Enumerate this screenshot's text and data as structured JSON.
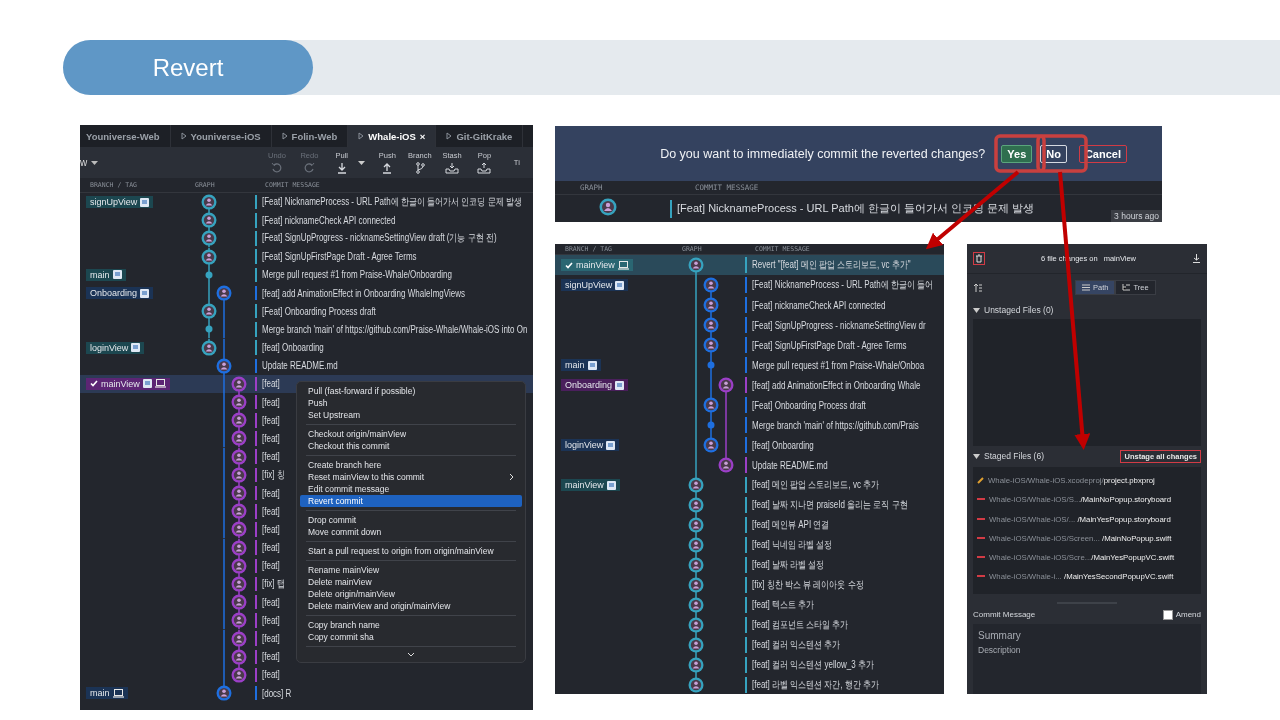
{
  "slide": {
    "title": "Revert"
  },
  "left_screenshot": {
    "tabs": [
      {
        "label": "Youniverse-Web",
        "selected": false,
        "icon": false
      },
      {
        "label": "Youniverse-iOS",
        "selected": false,
        "icon": true
      },
      {
        "label": "Folin-Web",
        "selected": false,
        "icon": true
      },
      {
        "label": "Whale-iOS",
        "selected": true,
        "icon": true,
        "close": "×"
      },
      {
        "label": "Git-GitKrake",
        "selected": false,
        "icon": true
      }
    ],
    "repo_selector": {
      "label": "w"
    },
    "toolbar": [
      {
        "label": "Undo",
        "kind": "undo",
        "disabled": true
      },
      {
        "label": "Redo",
        "kind": "redo",
        "disabled": true
      },
      {
        "label": "Pull",
        "kind": "pull",
        "disabled": false,
        "dropdown": true
      },
      {
        "label": "Push",
        "kind": "push",
        "disabled": false
      },
      {
        "label": "Branch",
        "kind": "branch",
        "disabled": false
      },
      {
        "label": "Stash",
        "kind": "stash",
        "disabled": false
      },
      {
        "label": "Pop",
        "kind": "pop",
        "disabled": false
      },
      {
        "label": "Ti",
        "kind": "other",
        "disabled": false
      }
    ],
    "columns": [
      "BRANCH / TAG",
      "GRAPH",
      "COMMIT MESSAGE"
    ],
    "rows": [
      {
        "branch": {
          "name": "signUpView",
          "color": "#1c4750",
          "checked": false,
          "doc_icon": true,
          "laptop_icon": false
        },
        "kind": "commit",
        "color": "#36a3bf",
        "message": "[Feat] NicknameProcess - URL Path에 한글이 들어가서 인코딩 문제 발생",
        "selected": false
      },
      {
        "kind": "commit",
        "color": "#36a3bf",
        "message": "[Feat] nicknameCheck API connected",
        "selected": false
      },
      {
        "kind": "commit",
        "color": "#36a3bf",
        "message": "[Feat] SignUpProgress - nicknameSettingView draft (기능 구현 전)",
        "selected": false
      },
      {
        "kind": "commit",
        "color": "#36a3bf",
        "message": "[Feat] SignUpFirstPage Draft - Agree Terms",
        "selected": false
      },
      {
        "branch": {
          "name": "main",
          "color": "#1c4750",
          "checked": false,
          "doc_icon": true,
          "laptop_icon": false
        },
        "kind": "merge",
        "color": "#36a3bf",
        "message": "Merge pull request #1 from Praise-Whale/Onboarding",
        "selected": false
      },
      {
        "branch": {
          "name": "Onboarding",
          "color": "#1b3355",
          "checked": false,
          "doc_icon": true,
          "laptop_icon": false
        },
        "kind": "commit",
        "color": "#1e6fe0",
        "message": "[feat] add AnimationEffect in Onboarding WhaleImgViews",
        "selected": false
      },
      {
        "kind": "commit",
        "color": "#36a3bf",
        "message": "[Feat] Onboarding Process draft",
        "selected": false
      },
      {
        "kind": "merge",
        "color": "#36a3bf",
        "message": "Merge branch 'main' of https://github.com/Praise-Whale/Whale-iOS into On",
        "selected": false
      },
      {
        "branch": {
          "name": "loginView",
          "color": "#1c4750",
          "checked": false,
          "doc_icon": true,
          "laptop_icon": false
        },
        "kind": "commit",
        "color": "#36a3bf",
        "message": "[feat] Onboarding",
        "selected": false
      },
      {
        "kind": "commit",
        "color": "#1e6fe0",
        "message": "Update README.md",
        "selected": false
      },
      {
        "branch": {
          "name": "mainView",
          "color": "#5c2574",
          "checked": true,
          "doc_icon": true,
          "laptop_icon": true
        },
        "kind": "commit",
        "color": "#9b3fc7",
        "message": "[feat]",
        "selected": true
      },
      {
        "kind": "commit",
        "color": "#9b3fc7",
        "message": "[feat]",
        "selected": false
      },
      {
        "kind": "commit",
        "color": "#9b3fc7",
        "message": "[feat]",
        "selected": false
      },
      {
        "kind": "commit",
        "color": "#9b3fc7",
        "message": "[feat]",
        "selected": false
      },
      {
        "kind": "commit",
        "color": "#9b3fc7",
        "message": "[feat]",
        "selected": false
      },
      {
        "kind": "commit",
        "color": "#9b3fc7",
        "message": "[fix] 칭",
        "selected": false
      },
      {
        "kind": "commit",
        "color": "#9b3fc7",
        "message": "[feat]",
        "selected": false
      },
      {
        "kind": "commit",
        "color": "#9b3fc7",
        "message": "[feat]",
        "selected": false
      },
      {
        "kind": "commit",
        "color": "#9b3fc7",
        "message": "[feat]",
        "selected": false
      },
      {
        "kind": "commit",
        "color": "#9b3fc7",
        "message": "[feat]",
        "selected": false
      },
      {
        "kind": "commit",
        "color": "#9b3fc7",
        "message": "[feat]",
        "selected": false
      },
      {
        "kind": "commit",
        "color": "#9b3fc7",
        "message": "[fix] 탭",
        "selected": false
      },
      {
        "kind": "commit",
        "color": "#9b3fc7",
        "message": "[feat]",
        "selected": false
      },
      {
        "kind": "commit",
        "color": "#9b3fc7",
        "message": "[feat]",
        "selected": false
      },
      {
        "kind": "commit",
        "color": "#9b3fc7",
        "message": "[feat]",
        "selected": false
      },
      {
        "kind": "commit",
        "color": "#9b3fc7",
        "message": "[feat]",
        "selected": false
      },
      {
        "kind": "commit",
        "color": "#9b3fc7",
        "message": "[feat]",
        "selected": false
      },
      {
        "branch": {
          "name": "main",
          "color": "#1b3355",
          "checked": false,
          "doc_icon": false,
          "laptop_icon": true
        },
        "kind": "commit",
        "color": "#1e6fe0",
        "message": "[docs] R",
        "selected": false
      }
    ],
    "context_menu": {
      "groups": [
        {
          "items": [
            {
              "label": "Pull (fast-forward if possible)",
              "selected": false
            },
            {
              "label": "Push",
              "selected": false
            },
            {
              "label": "Set Upstream",
              "selected": false
            }
          ]
        },
        {
          "items": [
            {
              "label": "Checkout origin/mainView",
              "selected": false
            },
            {
              "label": "Checkout this commit",
              "selected": false
            }
          ]
        },
        {
          "items": [
            {
              "label": "Create branch here",
              "selected": false
            },
            {
              "label": "Reset mainView to this commit",
              "selected": false,
              "submenu": true
            },
            {
              "label": "Edit commit message",
              "selected": false
            },
            {
              "label": "Revert commit",
              "selected": true
            }
          ]
        },
        {
          "items": [
            {
              "label": "Drop commit",
              "selected": false
            },
            {
              "label": "Move commit down",
              "selected": false
            }
          ]
        },
        {
          "items": [
            {
              "label": "Start a pull request to origin from origin/mainView",
              "selected": false
            }
          ]
        },
        {
          "items": [
            {
              "label": "Rename mainView",
              "selected": false
            },
            {
              "label": "Delete mainView",
              "selected": false
            },
            {
              "label": "Delete origin/mainView",
              "selected": false
            },
            {
              "label": "Delete mainView and origin/mainView",
              "selected": false
            }
          ]
        },
        {
          "items": [
            {
              "label": "Copy branch name",
              "selected": false
            },
            {
              "label": "Copy commit sha",
              "selected": false
            }
          ]
        }
      ]
    }
  },
  "dialog_screenshot": {
    "question": "Do you want to immediately commit the reverted changes?",
    "buttons": [
      {
        "label": "Yes",
        "kind": "confirm"
      },
      {
        "label": "No",
        "kind": "plain"
      },
      {
        "label": "Cancel",
        "kind": "cancel"
      }
    ],
    "columns": [
      "GRAPH",
      "COMMIT MESSAGE"
    ],
    "row": {
      "message": "[Feat] NicknameProcess - URL Path에 한글이 들어가서 인코딩 문제 발생",
      "color": "#36a3bf"
    },
    "tooltip": "3 hours ago"
  },
  "graph_screenshot": {
    "columns": [
      "BRANCH / TAG",
      "GRAPH",
      "COMMIT MESSAGE"
    ],
    "rows": [
      {
        "branch": {
          "name": "mainView",
          "color": "#2a6672",
          "checked": true,
          "doc_icon": false,
          "laptop_icon": true
        },
        "kind": "commit",
        "color": "#36a3bf",
        "message": "Revert \"[feat] 메인 팝업 스토리보드, vc 추가\"",
        "selected": true
      },
      {
        "branch": {
          "name": "signUpView",
          "color": "#1b3355",
          "checked": false,
          "doc_icon": true,
          "laptop_icon": false
        },
        "kind": "commit",
        "color": "#1e6fe0",
        "message": "[Feat] NicknameProcess - URL Path에 한글이 들어",
        "selected": false
      },
      {
        "kind": "commit",
        "color": "#1e6fe0",
        "message": "[Feat] nicknameCheck API connected",
        "selected": false
      },
      {
        "kind": "commit",
        "color": "#1e6fe0",
        "message": "[Feat] SignUpProgress - nicknameSettingView dr",
        "selected": false
      },
      {
        "kind": "commit",
        "color": "#1e6fe0",
        "message": "[Feat] SignUpFirstPage Draft - Agree Terms",
        "selected": false
      },
      {
        "branch": {
          "name": "main",
          "color": "#1b3355",
          "checked": false,
          "doc_icon": true,
          "laptop_icon": false
        },
        "kind": "merge",
        "color": "#1e6fe0",
        "message": "Merge pull request #1 from Praise-Whale/Onboa",
        "selected": false
      },
      {
        "branch": {
          "name": "Onboarding",
          "color": "#4a1f5c",
          "checked": false,
          "doc_icon": true,
          "laptop_icon": false
        },
        "kind": "commit",
        "color": "#9b3fc7",
        "message": "[feat] add AnimationEffect in Onboarding Whale",
        "selected": false
      },
      {
        "kind": "commit",
        "color": "#1e6fe0",
        "message": "[Feat] Onboarding Process draft",
        "selected": false
      },
      {
        "kind": "merge",
        "color": "#1e6fe0",
        "message": "Merge branch 'main' of https://github.com/Prais",
        "selected": false
      },
      {
        "branch": {
          "name": "loginView",
          "color": "#1b3355",
          "checked": false,
          "doc_icon": true,
          "laptop_icon": false
        },
        "kind": "commit",
        "color": "#1e6fe0",
        "message": "[feat] Onboarding",
        "selected": false
      },
      {
        "kind": "commit",
        "color": "#9b3fc7",
        "message": "Update README.md",
        "selected": false
      },
      {
        "branch": {
          "name": "mainView",
          "color": "#1c4750",
          "checked": false,
          "doc_icon": true,
          "laptop_icon": false
        },
        "kind": "commit",
        "color": "#36a3bf",
        "message": "[feat] 메인 팝업 스토리보드, vc 추가",
        "selected": false
      },
      {
        "kind": "commit",
        "color": "#36a3bf",
        "message": "[feat] 날짜 지나면 praiseId 올리는 로직 구현",
        "selected": false
      },
      {
        "kind": "commit",
        "color": "#36a3bf",
        "message": "[feat] 메인뷰 API 연결",
        "selected": false
      },
      {
        "kind": "commit",
        "color": "#36a3bf",
        "message": "[feat] 닉네임 라벨 설정",
        "selected": false
      },
      {
        "kind": "commit",
        "color": "#36a3bf",
        "message": "[feat] 날짜 라벨 설정",
        "selected": false
      },
      {
        "kind": "commit",
        "color": "#36a3bf",
        "message": "[fix] 칭찬 박스 뷰 레이아웃 수정",
        "selected": false
      },
      {
        "kind": "commit",
        "color": "#36a3bf",
        "message": "[feat] 텍스트 추가",
        "selected": false
      },
      {
        "kind": "commit",
        "color": "#36a3bf",
        "message": "[feat] 컴포넌트 스타일 추가",
        "selected": false
      },
      {
        "kind": "commit",
        "color": "#36a3bf",
        "message": "[feat] 컬러 익스텐션 추가",
        "selected": false
      },
      {
        "kind": "commit",
        "color": "#36a3bf",
        "message": "[feat] 컬러 익스텐션 yellow_3 추가",
        "selected": false
      },
      {
        "kind": "commit",
        "color": "#36a3bf",
        "message": "[feat] 라벨 익스텐션 자간, 행간 추가",
        "selected": false
      }
    ]
  },
  "changes_screenshot": {
    "summary": "6 file changes on",
    "branch": "mainView",
    "view_toggle": [
      {
        "label": "Path",
        "selected": true
      },
      {
        "label": "Tree",
        "selected": false
      }
    ],
    "unstaged": {
      "title": "Unstaged Files (0)",
      "expanded": true
    },
    "staged": {
      "title": "Staged Files (6)",
      "expanded": true,
      "action": "Unstage all changes"
    },
    "files": [
      {
        "dir": "Whale-iOS/Whale-iOS.xcodeproj/",
        "name": "project.pbxproj",
        "kind": "modified"
      },
      {
        "dir": "Whale-iOS/Whale-iOS/S...",
        "name": "/MainNoPopup.storyboard",
        "kind": "deleted"
      },
      {
        "dir": "Whale-iOS/Whale-iOS/... ",
        "name": "/MainYesPopup.storyboard",
        "kind": "deleted"
      },
      {
        "dir": "Whale-iOS/Whale-iOS/Screen... ",
        "name": "/MainNoPopup.swift",
        "kind": "deleted"
      },
      {
        "dir": "Whale-iOS/Whale-iOS/Scre...",
        "name": "/MainYesPopupVC.swift",
        "kind": "deleted"
      },
      {
        "dir": "Whale-iOS/Whale-i... ",
        "name": "/MainYesSecondPopupVC.swift",
        "kind": "deleted"
      }
    ],
    "commit": {
      "title": "Commit Message",
      "amend": {
        "label": "Amend",
        "checked": false
      },
      "summary_placeholder": "Summary",
      "description_placeholder": "Description"
    }
  }
}
